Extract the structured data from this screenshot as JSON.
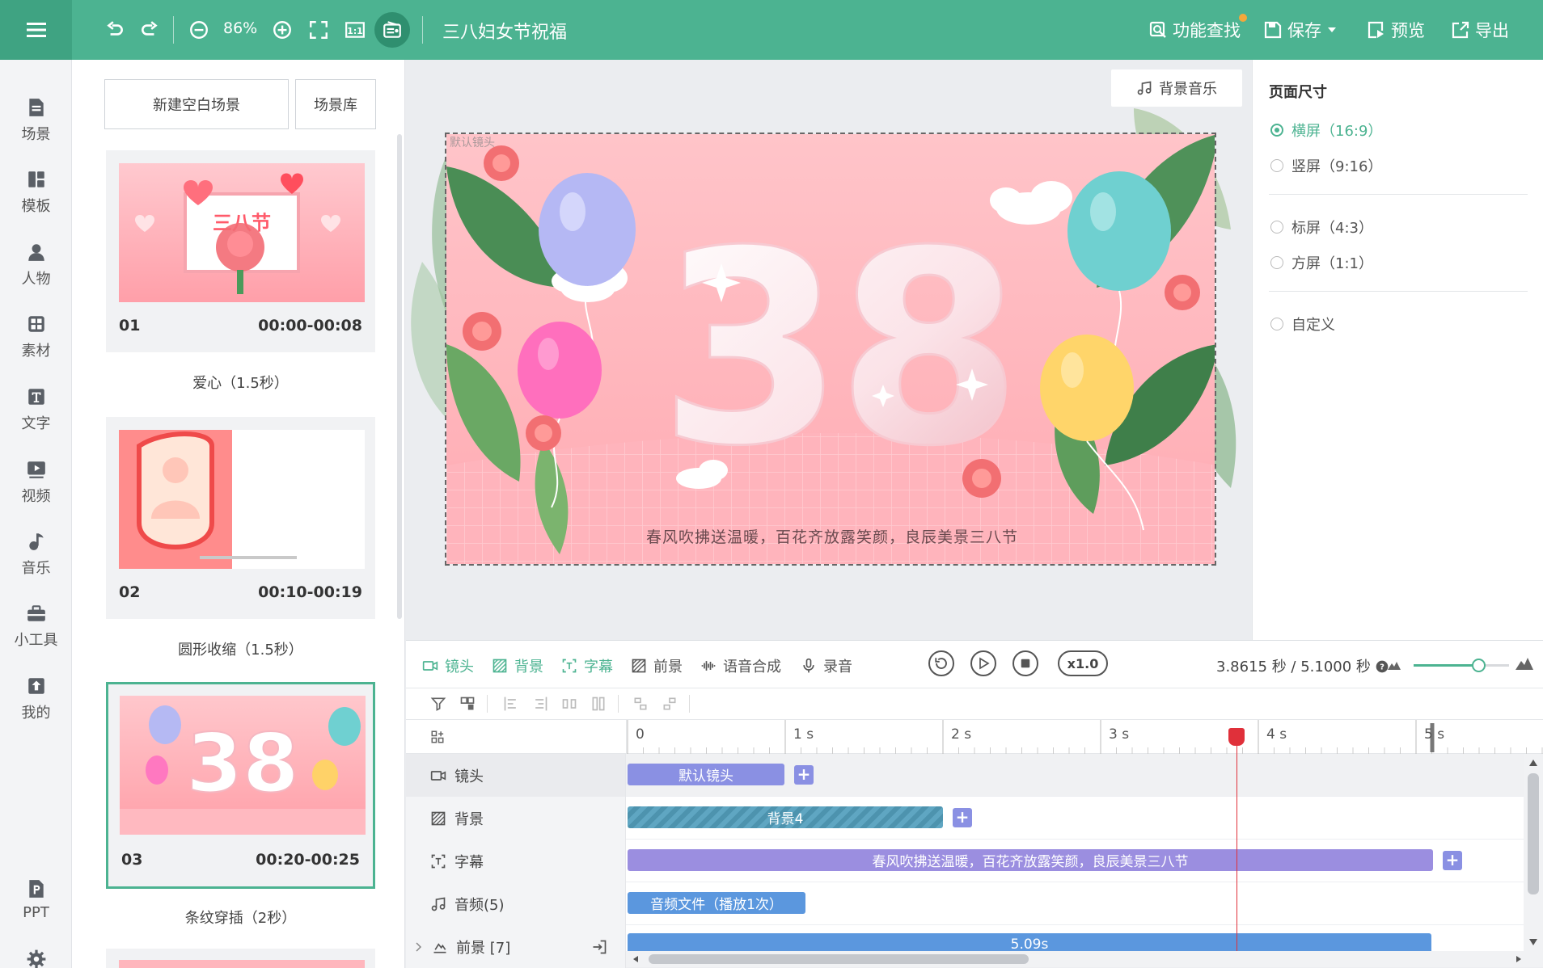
{
  "topbar": {
    "zoom": "86%",
    "title": "三八妇女节祝福",
    "find": "功能查找",
    "save": "保存",
    "preview": "预览",
    "export": "导出"
  },
  "sidebar": {
    "items": [
      {
        "label": "场景",
        "icon": "scene-icon"
      },
      {
        "label": "模板",
        "icon": "template-icon"
      },
      {
        "label": "人物",
        "icon": "person-icon"
      },
      {
        "label": "素材",
        "icon": "material-icon"
      },
      {
        "label": "文字",
        "icon": "text-icon"
      },
      {
        "label": "视频",
        "icon": "video-icon"
      },
      {
        "label": "音乐",
        "icon": "music-icon"
      },
      {
        "label": "小工具",
        "icon": "toolbox-icon"
      },
      {
        "label": "我的",
        "icon": "upload-icon"
      },
      {
        "label": "PPT",
        "icon": "ppt-icon"
      },
      {
        "label": "设置",
        "icon": "gear-icon"
      }
    ]
  },
  "scenes": {
    "new_blank": "新建空白场景",
    "library": "场景库",
    "items": [
      {
        "num": "01",
        "time": "00:00-00:08",
        "transition": "爱心（1.5秒）",
        "thumb_text": "三八节"
      },
      {
        "num": "02",
        "time": "00:10-00:19",
        "transition": "圆形收缩（1.5秒）"
      },
      {
        "num": "03",
        "time": "00:20-00:25",
        "transition": "条纹穿插（2秒）",
        "thumb_text": "38"
      }
    ]
  },
  "canvas": {
    "bgm_button": "背景音乐",
    "camera_label": "默认镜头",
    "big_text": "38",
    "subtitle": "春风吹拂送温暖，百花齐放露笑颜，良辰美景三八节"
  },
  "props": {
    "title": "页面尺寸",
    "options": [
      "横屏（16:9）",
      "竖屏（9:16）",
      "标屏（4:3）",
      "方屏（1:1）",
      "自定义"
    ],
    "selected": "横屏（16:9）"
  },
  "timeline": {
    "tabs": [
      "镜头",
      "背景",
      "字幕",
      "前景",
      "语音合成",
      "录音"
    ],
    "speed": "x1.0",
    "time_info": "3.8615 秒 / 5.1000 秒",
    "ruler": [
      "0",
      "1 s",
      "2 s",
      "3 s",
      "4 s",
      "5 s"
    ],
    "tracks": [
      {
        "label": "镜头",
        "clip": "默认镜头"
      },
      {
        "label": "背景",
        "clip": "背景4"
      },
      {
        "label": "字幕",
        "clip": "春风吹拂送温暖，百花齐放露笑颜，良辰美景三八节"
      },
      {
        "label": "音频(5)",
        "clip": "音频文件（播放1次）"
      },
      {
        "label": "前景 [7]",
        "clip": "5.09s"
      }
    ],
    "playhead_seconds": 3.8615,
    "total_seconds": 5.1
  },
  "colors": {
    "brand": "#4cb391",
    "camera_clip": "#8a90e3",
    "bg_clip": "#5fa6c2",
    "subtitle_clip": "#9b8ee0",
    "audio_clip": "#5b97de",
    "fg_clip": "#5b97de"
  }
}
